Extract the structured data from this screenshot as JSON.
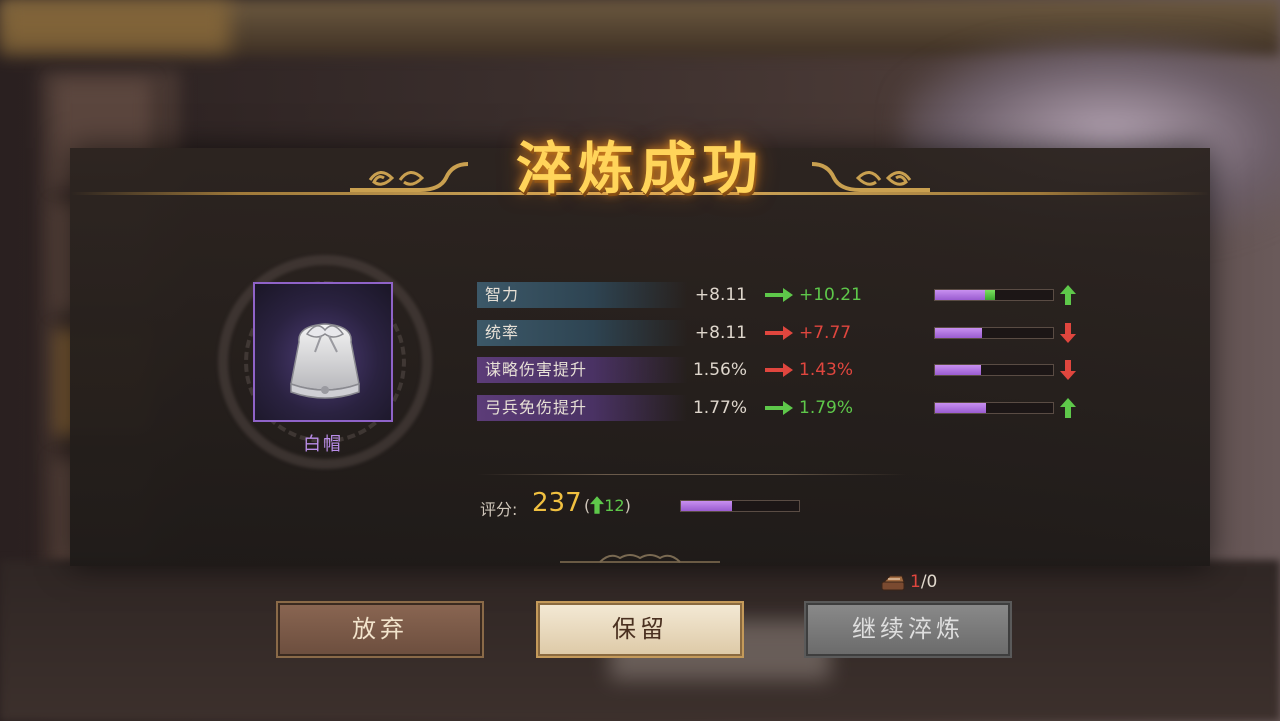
{
  "dialog": {
    "title": "淬炼成功"
  },
  "item": {
    "name": "白帽",
    "quality_color": "#8f63c8",
    "icon": "white-hat-icon"
  },
  "stats": [
    {
      "label": "智力",
      "old": "+8.11",
      "new": "+10.21",
      "direction": "up",
      "bar_base": 0.42,
      "bar_gain": 0.09
    },
    {
      "label": "统率",
      "old": "+8.11",
      "new": "+7.77",
      "direction": "down",
      "bar_base": 0.4,
      "bar_gain": 0
    },
    {
      "label": "谋略伤害提升",
      "old": "1.56%",
      "new": "1.43%",
      "direction": "down",
      "bar_base": 0.39,
      "bar_gain": 0
    },
    {
      "label": "弓兵免伤提升",
      "old": "1.77%",
      "new": "1.79%",
      "direction": "up",
      "bar_base": 0.43,
      "bar_gain": 0
    }
  ],
  "score": {
    "label": "评分:",
    "value": "237",
    "paren_open": "(",
    "increase": "12",
    "paren_close": ")",
    "bar_fill": 0.43
  },
  "cost": {
    "icon": "whetstone-icon",
    "owned": "1",
    "separator": "/0"
  },
  "buttons": {
    "abandon": "放弃",
    "keep": "保留",
    "continue": "继续淬炼"
  },
  "colors": {
    "up": "#5ec84a",
    "down": "#e0463e",
    "title": "#ffd45a",
    "score": "#f0c040"
  }
}
